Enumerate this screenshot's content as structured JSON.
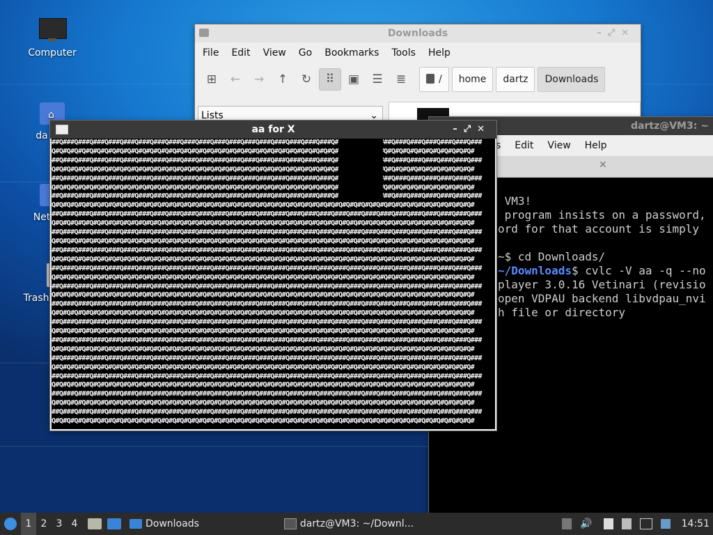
{
  "desktop": {
    "icons": [
      {
        "label": "Computer"
      },
      {
        "label": "da"
      },
      {
        "label": "Net"
      },
      {
        "label": "Trash"
      }
    ]
  },
  "file_manager": {
    "title": "Downloads",
    "menu": [
      "File",
      "Edit",
      "View",
      "Go",
      "Bookmarks",
      "Tools",
      "Help"
    ],
    "breadcrumbs": [
      "/",
      "home",
      "dartz",
      "Downloads"
    ],
    "side_selector": "Lists"
  },
  "terminal": {
    "title": "dartz@VM3: ~",
    "menu": [
      "s",
      "Edit",
      "View",
      "Help"
    ],
    "lines": [
      {
        "t": " VM3!"
      },
      {
        "t": " program insists on a password,"
      },
      {
        "t": "ord for that account is simply"
      },
      {
        "t": ""
      },
      {
        "t": "~$ cd Downloads/"
      },
      {
        "blue": "~/Downloads",
        "t": "$ cvlc -V aa -q --no"
      },
      {
        "t": "player 3.0.16 Vetinari (revisio"
      },
      {
        "t": "open VDPAU backend libvdpau_nvi"
      },
      {
        "t": "h file or directory"
      }
    ]
  },
  "aa_window": {
    "title": "aa for X"
  },
  "taskbar": {
    "workspaces": [
      "1",
      "2",
      "3",
      "4"
    ],
    "tasks": [
      {
        "label": "Downloads"
      },
      {
        "label": "dartz@VM3: ~/Downl..."
      }
    ],
    "clock": "14:51"
  },
  "colors": {
    "terminal_prompt": "#5a8cff",
    "taskbar": "#2b2b2b"
  }
}
